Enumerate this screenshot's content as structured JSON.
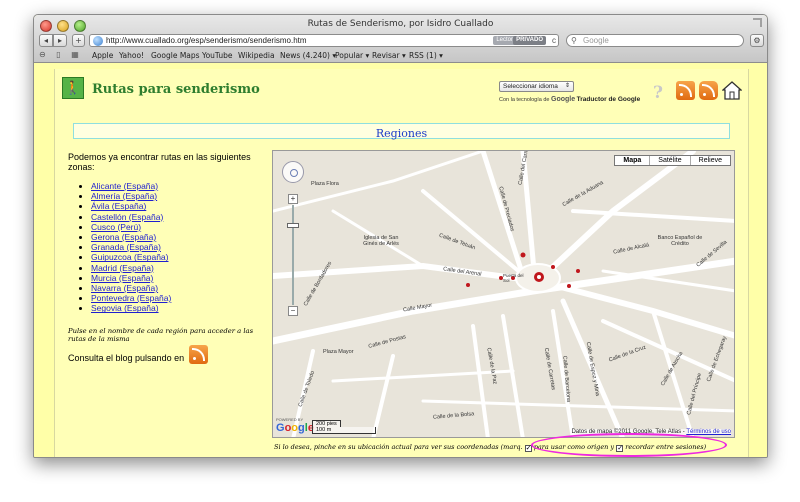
{
  "window": {
    "title": "Rutas de Senderismo, por Isidro Cuallado"
  },
  "toolbar": {
    "back_icon": "◂",
    "forward_icon": "▸",
    "add_icon": "+",
    "url": "http://www.cuallado.org/esp/senderismo/senderismo.htm",
    "lector_label": "Lector",
    "privado_label": "PRIVADO",
    "reload_icon": "c",
    "search_placeholder": "Google",
    "settings_icon": "⚙"
  },
  "bookmarks": {
    "icons": "⊖ ▯ ▦",
    "items": [
      {
        "label": "Apple"
      },
      {
        "label": "Yahoo!"
      },
      {
        "label": "Google Maps"
      },
      {
        "label": "YouTube"
      },
      {
        "label": "Wikipedia"
      },
      {
        "label": "News (4.240) ▾"
      },
      {
        "label": "Popular ▾"
      },
      {
        "label": "Revisar ▾"
      },
      {
        "label": "RSS (1) ▾"
      }
    ]
  },
  "header": {
    "site_title": "Rutas para senderismo",
    "logo_icon": "🚶",
    "language_select": "Seleccionar idioma",
    "select_arrow": "⇕",
    "translate_prefix": "Con la tecnología de",
    "translate_google": "Google",
    "translate_suffix": "Traductor de Google",
    "help_icon": "?"
  },
  "main": {
    "section_title": "Regiones",
    "intro": "Podemos ya encontrar rutas en las siguientes zonas:",
    "regions": [
      "Alicante (España)",
      "Almería (España)",
      "Ávila (España)",
      "Castellón (España)",
      "Cusco (Perú)",
      "Gerona (España)",
      "Granada (España)",
      "Guipuzcoa (España)",
      "Madrid (España)",
      "Murcia (España)",
      "Navarra (España)",
      "Pontevedra (España)",
      "Segovia (España)"
    ],
    "instruction": "Pulse en el nombre de cada región para acceder a las rutas de la misma",
    "blog_text": "Consulta el blog pulsando en"
  },
  "map": {
    "types": [
      "Mapa",
      "Satélite",
      "Relieve"
    ],
    "zoom_in": "+",
    "zoom_out": "−",
    "streets": [
      "Calle de la Aduana",
      "Calle de Alcalá",
      "Calle de Sevilla",
      "Calle del Arenal",
      "Calle Mayor",
      "Calle de Postas",
      "Plaza Mayor",
      "Calle de Toledo",
      "Calle de Atocha",
      "Calle de la Cruz",
      "Calle de Carretas",
      "Calle de Espoz y Mina",
      "Calle de la Bolsa",
      "Calle de la Paz",
      "Calle de Barcelona",
      "Calle del Carmen",
      "Calle de Preciados",
      "Calle de Tetuán",
      "Calle de Bordadores",
      "Calle de Echegaray",
      "Calle del Príncipe",
      "Plaza Flora",
      "Iglesia de San Ginés de Arlés",
      "Banco Español de Crédito",
      "Puerta del Sol"
    ],
    "google_logo": "Google",
    "powered_by": "POWERED BY",
    "scale_top": "200 pies",
    "scale_bottom": "100 m",
    "attribution": "Datos de mapa ©2011 Google, Tele Atlas -",
    "terms": "Términos de uso"
  },
  "footer_note": {
    "before": "Si lo desea, pinche en su ubicación actual para ver sus coordenadas (marq.",
    "check_origin": "para usar como origen y",
    "check_remember": "recordar entre sesiones)",
    "check_mark": "✓"
  }
}
